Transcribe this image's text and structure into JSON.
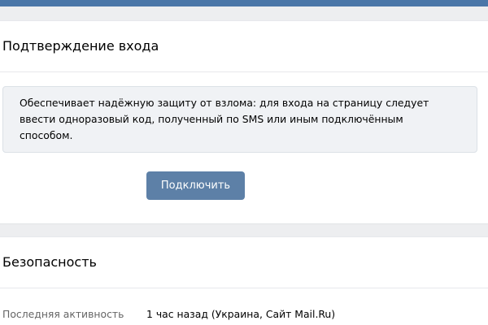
{
  "colors": {
    "top_bar": "#4a76a8",
    "page_background": "#edeef0",
    "info_box_background": "#f0f2f5",
    "button_background": "#5d80a7",
    "button_text": "#ffffff",
    "label_text": "#656565"
  },
  "login_confirmation": {
    "title": "Подтверждение входа",
    "description_lines": [
      "Обеспечивает надёжную защиту от взлома: для входа на страницу следует",
      "ввести одноразовый код, полученный по SMS или иным подключённым",
      "способом."
    ],
    "connect_button_label": "Подключить"
  },
  "security": {
    "title": "Безопасность",
    "last_activity": {
      "label": "Последняя активность",
      "value": "1 час назад (Украина, Сайт Mail.Ru)"
    }
  }
}
